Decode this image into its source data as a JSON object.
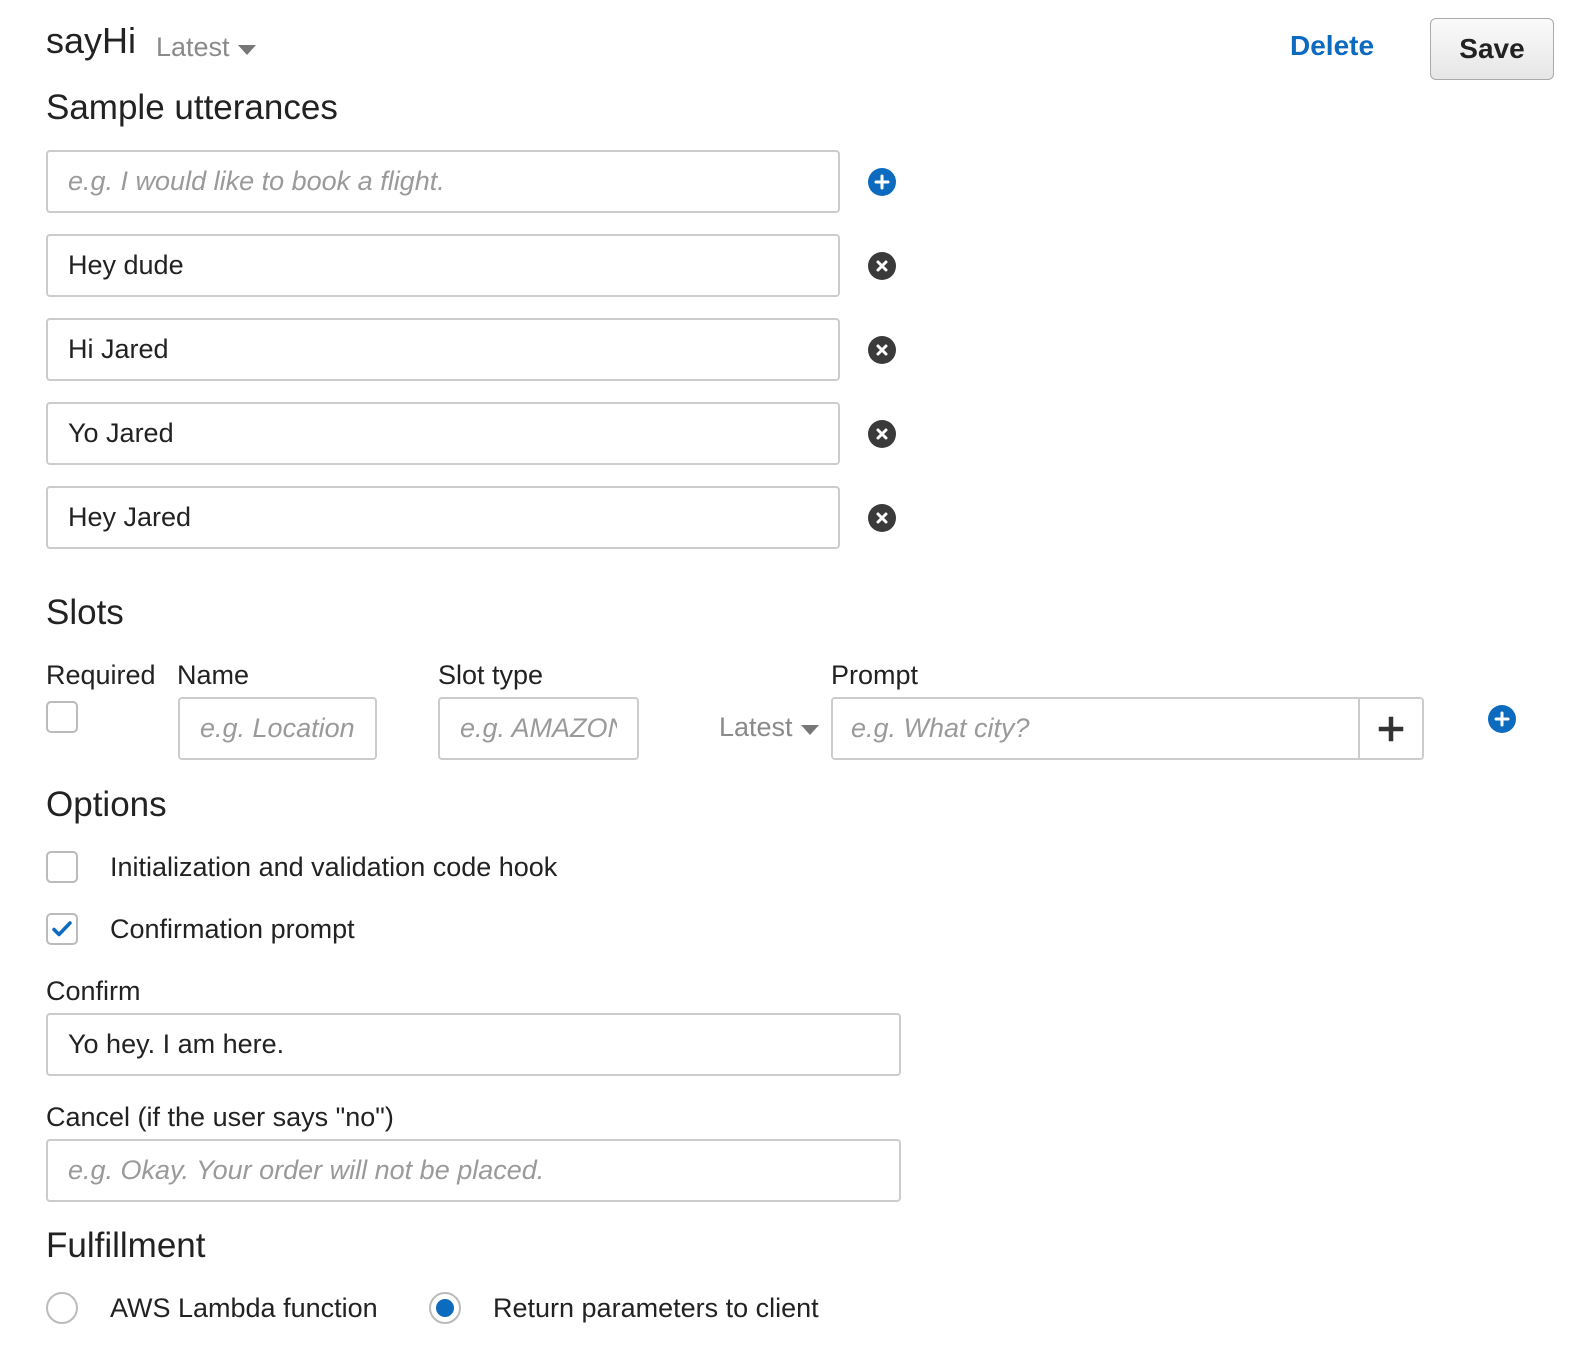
{
  "header": {
    "intent_name": "sayHi",
    "version": "Latest",
    "delete_label": "Delete",
    "save_label": "Save"
  },
  "utterances": {
    "title": "Sample utterances",
    "new_placeholder": "e.g. I would like to book a flight.",
    "items": [
      "Hey dude",
      "Hi Jared",
      "Yo Jared",
      "Hey Jared"
    ]
  },
  "slots": {
    "title": "Slots",
    "col_required": "Required",
    "col_name": "Name",
    "col_slot_type": "Slot type",
    "col_prompt": "Prompt",
    "name_placeholder": "e.g. Location",
    "slot_type_placeholder": "e.g. AMAZON.US_CITY",
    "version": "Latest",
    "prompt_placeholder": "e.g. What city?",
    "required_checked": false
  },
  "options": {
    "title": "Options",
    "code_hook_label": "Initialization and validation code hook",
    "code_hook_checked": false,
    "confirmation_label": "Confirmation prompt",
    "confirmation_checked": true,
    "confirm_label": "Confirm",
    "confirm_value": "Yo hey. I am here.",
    "cancel_label": "Cancel (if the user says \"no\")",
    "cancel_placeholder": "e.g. Okay. Your order will not be placed."
  },
  "fulfillment": {
    "title": "Fulfillment",
    "lambda_label": "AWS Lambda function",
    "return_label": "Return parameters to client",
    "selected": "return"
  },
  "colors": {
    "accent": "#0d6bbf",
    "remove_icon": "#3a3a3a",
    "border": "#cccccc"
  }
}
